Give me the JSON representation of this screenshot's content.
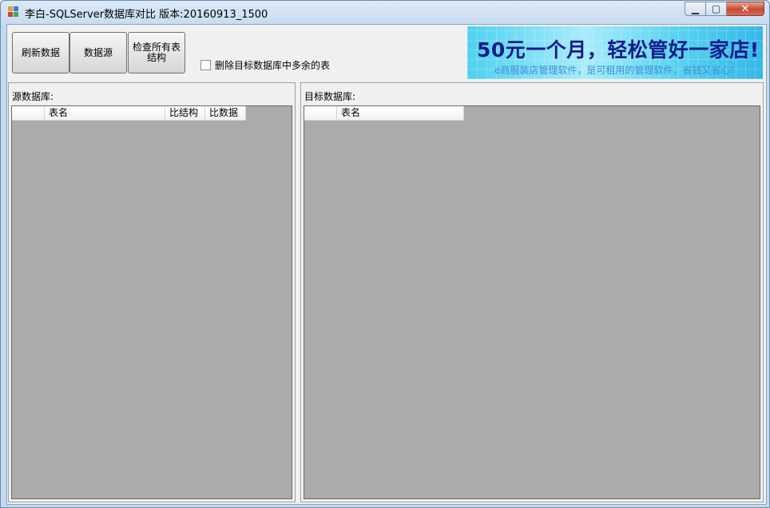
{
  "window": {
    "title": "李白-SQLServer数据库对比 版本:20160913_1500",
    "icon": "app-window-icon",
    "controls": {
      "minimize": "minimize-icon",
      "maximize": "maximize-icon",
      "close": "close-icon"
    }
  },
  "toolbar": {
    "refresh_label": "刷新数据",
    "datasource_label": "数据源",
    "check_structure_line1": "检查所有表",
    "check_structure_line2": "结构",
    "delete_extra_label": "删除目标数据库中多余的表",
    "delete_extra_checked": false
  },
  "banner": {
    "headline": "50元一个月，轻松管好一家店!",
    "subline": "e商服装店管理软件，是可租用的管理软件，省钱又省心!"
  },
  "source_panel": {
    "label": "源数据库:",
    "columns": [
      "",
      "表名",
      "比结构",
      "比数据"
    ]
  },
  "target_panel": {
    "label": "目标数据库:",
    "columns": [
      "",
      "表名"
    ]
  },
  "colors": {
    "titlebar": "#c8dcf2",
    "grid_background": "#ababab",
    "banner_text": "#131c8c",
    "close_button": "#c7482e"
  }
}
